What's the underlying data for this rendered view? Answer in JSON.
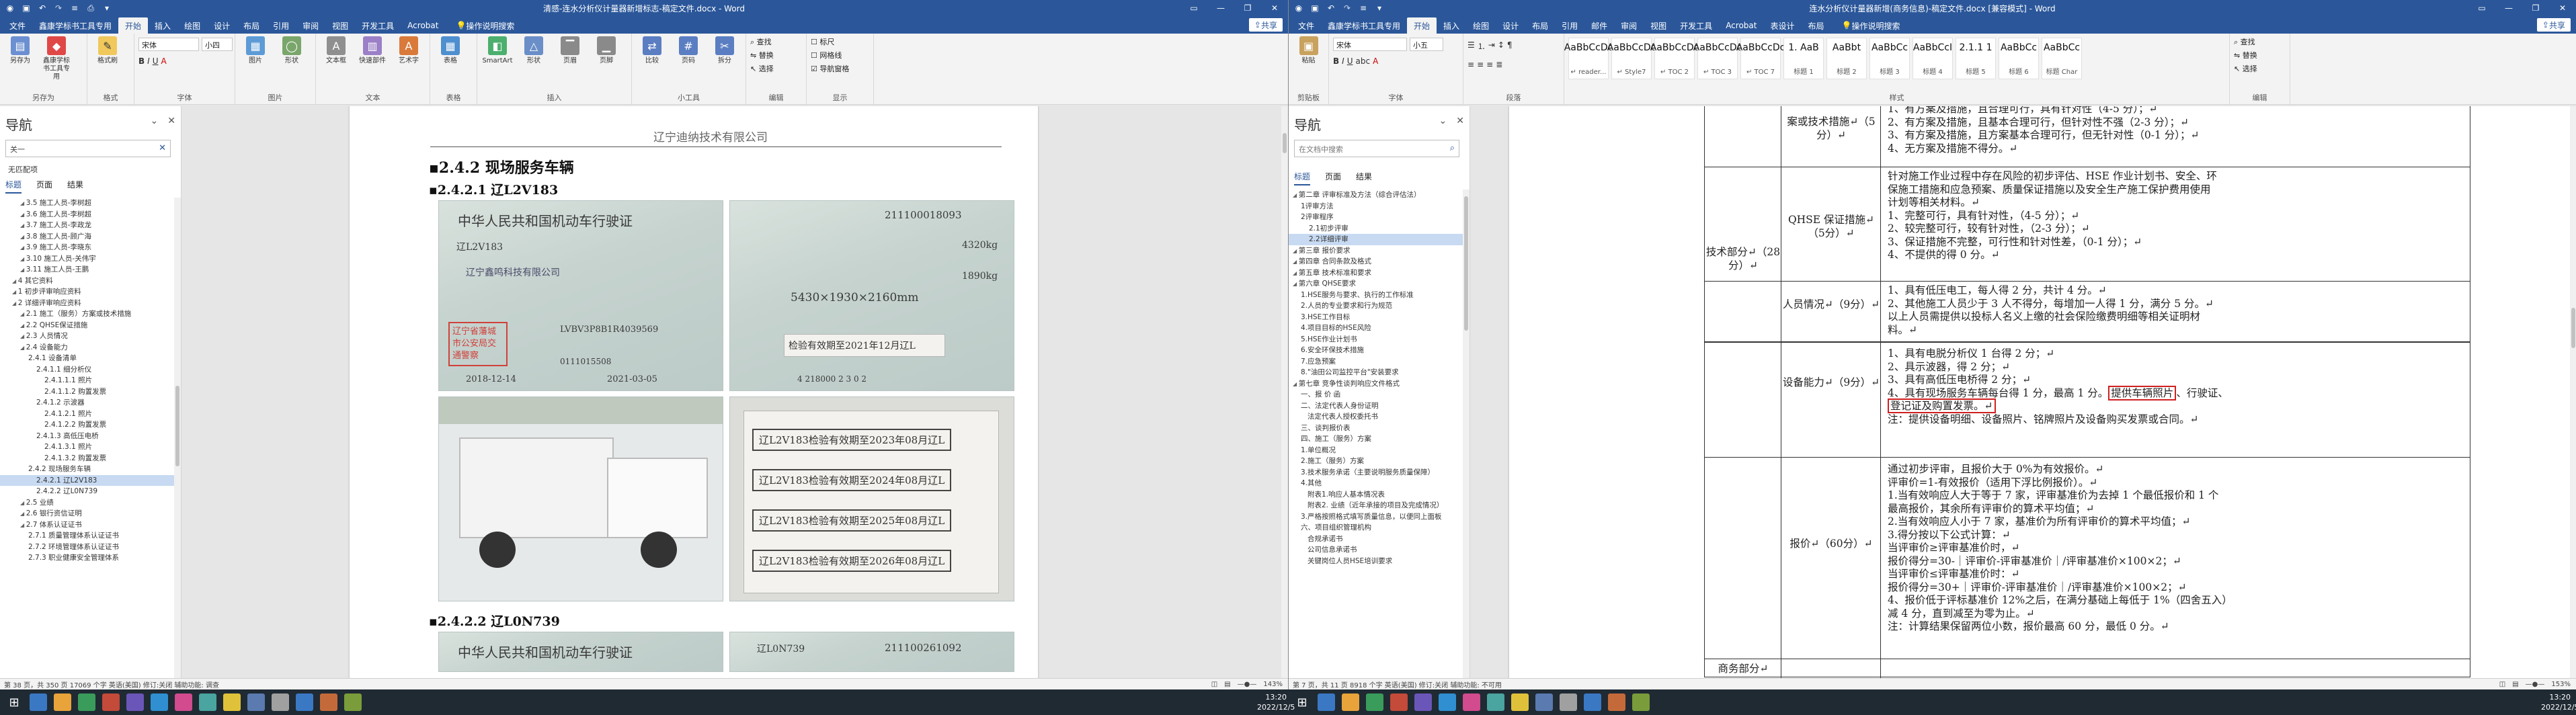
{
  "left": {
    "window_title": "清感-连水分析仪计量器新增标志-稿定文件.docx - Word",
    "tabs": [
      "文件",
      "鑫康学标书工具专用",
      "开始",
      "插入",
      "绘图",
      "设计",
      "布局",
      "引用",
      "审阅",
      "视图",
      "开发工具",
      "Acrobat"
    ],
    "search_label": "操作说明搜索",
    "share_label": "共享",
    "ribbon_groups": [
      {
        "label": "另存为",
        "buttons": [
          "另存为",
          "鑫康学标书工具专用"
        ]
      },
      {
        "label": "格式",
        "buttons": [
          "格式刷"
        ]
      },
      {
        "label": "字体",
        "font": "宋体",
        "size": "小四"
      },
      {
        "label": "图片",
        "buttons": [
          "图片",
          "形状"
        ]
      },
      {
        "label": "文本",
        "buttons": [
          "文本框",
          "快速部件",
          "艺术字"
        ]
      },
      {
        "label": "表格",
        "buttons": [
          "表格"
        ]
      },
      {
        "label": "插入",
        "buttons": [
          "SmartArt",
          "形状",
          "页眉",
          "页脚"
        ]
      },
      {
        "label": "小工具",
        "buttons": [
          "比较",
          "页码",
          "拆分"
        ]
      },
      {
        "label": "编辑",
        "buttons": [
          "查找",
          "替换",
          "选择"
        ]
      },
      {
        "label": "显示",
        "options": [
          "标尺",
          "网格线",
          "导航窗格"
        ]
      }
    ],
    "nav": {
      "title": "导航",
      "search_value": "关一",
      "result_text": "无匹配项",
      "tabs": [
        "标题",
        "页面",
        "结果"
      ],
      "items": [
        "3.5 施工人员-李树超",
        "3.6 施工人员-李树超",
        "3.7 施工人员-李政龙",
        "3.8 施工人员-顾广海",
        "3.9 施工人员-李晓东",
        "3.10 施工人员-关伟宇",
        "3.11 施工人员-王鹏",
        "4 其它资料",
        "1 初步评审响应资料",
        "2 详细评审响应资料",
        "2.1 施工（服务）方案或技术措施",
        "2.2 QHSE保证措施",
        "2.3 人员情况",
        "2.4 设备能力",
        "2.4.1 设备清单",
        "2.4.1.1 细分析仪",
        "2.4.1.1.1 照片",
        "2.4.1.1.2 购置发票",
        "2.4.1.2 示波器",
        "2.4.1.2.1 照片",
        "2.4.1.2.2 购置发票",
        "2.4.1.3 高低压电桥",
        "2.4.1.3.1 照片",
        "2.4.1.3.2 购置发票",
        "2.4.2 现场服务车辆",
        "2.4.2.1 辽L2V183",
        "2.4.2.2 辽L0N739",
        "2.5 业绩",
        "2.6 银行资信证明",
        "2.7 体系认证证书",
        "2.7.1 质量管理体系认证证书",
        "2.7.2 环境管理体系认证证书",
        "2.7.3 职业健康安全管理体系"
      ],
      "selected_index": 25
    },
    "doc": {
      "header": "辽宁迪纳技术有限公司",
      "h1": "▪2.4.2  现场服务车辆",
      "h2a": "▪2.4.2.1  辽L2V183",
      "h2b": "▪2.4.2.2  辽L0N739",
      "photo1_title": "中华人民共和国机动车行驶证",
      "photo1_plate": "辽L2V183",
      "photo1_number": "211100018093",
      "photo1_weight": "4320kg",
      "photo1_weight2": "1890kg",
      "photo1_dims": "5430×1930×2160mm",
      "photo1_inspect": "检验有效期至2021年12月辽L",
      "photo1_stamp": "辽宁省藩城市公安局交通警察",
      "photo2_stamps": [
        "辽L2V183检验有效期至2023年08月辽L",
        "辽L2V183检验有效期至2024年08月辽L",
        "辽L2V183检验有效期至2025年08月辽L",
        "辽L2V183检验有效期至2026年08月辽L"
      ],
      "photo3_title": "中华人民共和国机动车行驶证",
      "photo3_plate": "辽L0N739",
      "photo3_number": "211100261092"
    },
    "status": {
      "left": "第 38 页，共 350 页    17069 个字    英语(美国)    修订:关闭    辅助功能: 调查",
      "zoom": "143%"
    }
  },
  "right": {
    "window_title": "连水分析仪计量器新增(商务信息)-稿定文件.docx [兼容模式] - Word",
    "tabs": [
      "文件",
      "鑫康学标书工具专用",
      "开始",
      "插入",
      "绘图",
      "设计",
      "布局",
      "引用",
      "邮件",
      "审阅",
      "视图",
      "开发工具",
      "Acrobat",
      "表设计",
      "布局"
    ],
    "search_label": "操作说明搜索",
    "share_label": "共享",
    "font": "宋体",
    "size": "小五",
    "styles": [
      {
        "s": "AaBbCcDc",
        "n": "↵ reader..."
      },
      {
        "s": "AaBbCcDc",
        "n": "↵ Style7"
      },
      {
        "s": "AaBbCcDc",
        "n": "↵ TOC 2"
      },
      {
        "s": "AaBbCcDc",
        "n": "↵ TOC 3"
      },
      {
        "s": "AaBbCcDc",
        "n": "↵ TOC 7"
      },
      {
        "s": "1. AaB",
        "n": "标题 1"
      },
      {
        "s": "AaBbt",
        "n": "标题 2"
      },
      {
        "s": "AaBbCc",
        "n": "标题 3"
      },
      {
        "s": "AaBbCcI",
        "n": "标题 4"
      },
      {
        "s": "2.1.1 1",
        "n": "标题 5"
      },
      {
        "s": "AaBbCc",
        "n": "标题 6"
      },
      {
        "s": "AaBbCc",
        "n": "标题 Char"
      }
    ],
    "nav": {
      "title": "导航",
      "search_placeholder": "在文档中搜索",
      "tabs": [
        "标题",
        "页面",
        "结果"
      ],
      "items": [
        "第二章 评审标准及方法（综合评估法）",
        "1评审方法",
        "2评审程序",
        "2.1初步评审",
        "2.2详细评审",
        "第三章 报价要求",
        "第四章 合同条款及格式",
        "第五章 技术标准和要求",
        "第六章 QHSE要求",
        "1.HSE服务与要求、执行的工作标准",
        "2.人员的专业要求和行为规范",
        "3.HSE工作目标",
        "4.项目目标的HSE风险",
        "5.HSE作业计划书",
        "6.安全环保技术措施",
        "7.应急预案",
        "8.\"油田公司监控平台\"安装要求",
        "第七章 竞争性谈判响应文件格式",
        "一、报 价 函",
        "二、法定代表人身份证明",
        "法定代表人授权委托书",
        "三、谈判报价表",
        "四、施工（服务）方案",
        "1.单位概况",
        "2.施工（服务）方案",
        "3.技术服务承诺（主要说明服务质量保障）",
        "4.其他",
        "附表1.响应人基本情况表",
        "附表2. 业绩（近年承接的项目及完成情况）",
        "3.严格按照格式填写质量信息，以便同上面板",
        "六、项目组织管理机构",
        "合规承诺书",
        "公司信息承诺书",
        "关键岗位人员HSE培训要求"
      ],
      "selected_index": 4
    },
    "table": {
      "cat_tech": "技术部分↵（28分）↵",
      "cat_business": "商务部分↵",
      "row0": {
        "label": "案或技术措施↵（5分）↵",
        "lines": [
          "1、有方案及措施，且合理可行，具有针对性（4-5 分）；↵",
          "2、有方案及措施，且基本合理可行，但针对性不强（2-3 分）；↵",
          "3、有方案及措施，且方案基本合理可行，但无针对性（0-1 分）；↵",
          "4、无方案及措施不得分。↵"
        ]
      },
      "row1": {
        "label": "QHSE 保证措施↵（5分）↵",
        "lines": [
          "针对施工作业过程中存在风险的初步评估、HSE 作业计划书、安全、环",
          "保施工措施和应急预案、质量保证措施以及安全生产施工保护费用使用",
          "计划等相关材料。↵",
          "1、完整可行，具有针对性，（4-5 分）；↵",
          "2、较完整可行，较有针对性，（2-3 分）；↵",
          "3、保证措施不完整，可行性和针对性差，（0-1 分）；↵",
          "4、不提供的得 0 分。↵"
        ]
      },
      "row2": {
        "label": "人员情况↵（9分）↵",
        "lines": [
          "1、具有低压电工，每人得 2 分，共计 4 分。↵",
          "2、其他施工人员少于 3 人不得分，每增加一人得 1 分，满分 5 分。↵",
          "以上人员需提供以投标人名义上缴的社会保险缴费明细等相关证明材",
          "料。↵"
        ]
      },
      "row3": {
        "label": "设备能力↵（9分）↵",
        "lines": [
          "1、具有电脱分析仪 1 台得 2 分；↵",
          "2、具示波器，得 2 分；↵",
          "3、具有高低压电桥得 2 分；↵",
          "4、具有现场服务车辆每台得 1 分，最高 1 分。"
        ],
        "box1": "提供车辆照片",
        "after1": "、行驶证、",
        "box2": "登记证及购置发票。↵",
        "line_last": "注：提供设备明细、设备照片、铭牌照片及设备购买发票或合同。↵"
      },
      "row4": {
        "label": "报价↵（60分）↵",
        "lines": [
          "通过初步评审，且报价大于 0%为有效报价。↵",
          "评审价=1-有效报价（适用下浮比例报价）。↵",
          "1.当有效响应人大于等于 7 家，评审基准价为去掉 1 个最低报价和 1 个",
          "最高报价，其余所有评审价的算术平均值；↵",
          "2.当有效响应人小于 7 家，基准价为所有评审价的算术平均值；↵",
          "3.得分按以下公式计算：↵",
          "当评审价≥评审基准价时，↵",
          "报价得分=30-｜评审价-评审基准价｜/评审基准价×100×2；↵",
          "当评审价≤评审基准价时：↵",
          "报价得分=30+｜评审价-评审基准价｜/评审基准价×100×2；↵",
          "4、报价低于评标基准价 12%之后，在满分基础上每低于 1%（四舍五入）",
          "减 4 分，直到减至为零为止。↵",
          "注：计算结果保留两位小数，报价最高 60 分，最低 0 分。↵"
        ]
      }
    },
    "status": {
      "left": "第 7 页，共 11 页    8918 个字    英语(美国)    修订:关闭    辅助功能: 不可用",
      "zoom": "153%"
    }
  },
  "taskbar": {
    "time": "13:20",
    "date": "2022/12/5"
  }
}
